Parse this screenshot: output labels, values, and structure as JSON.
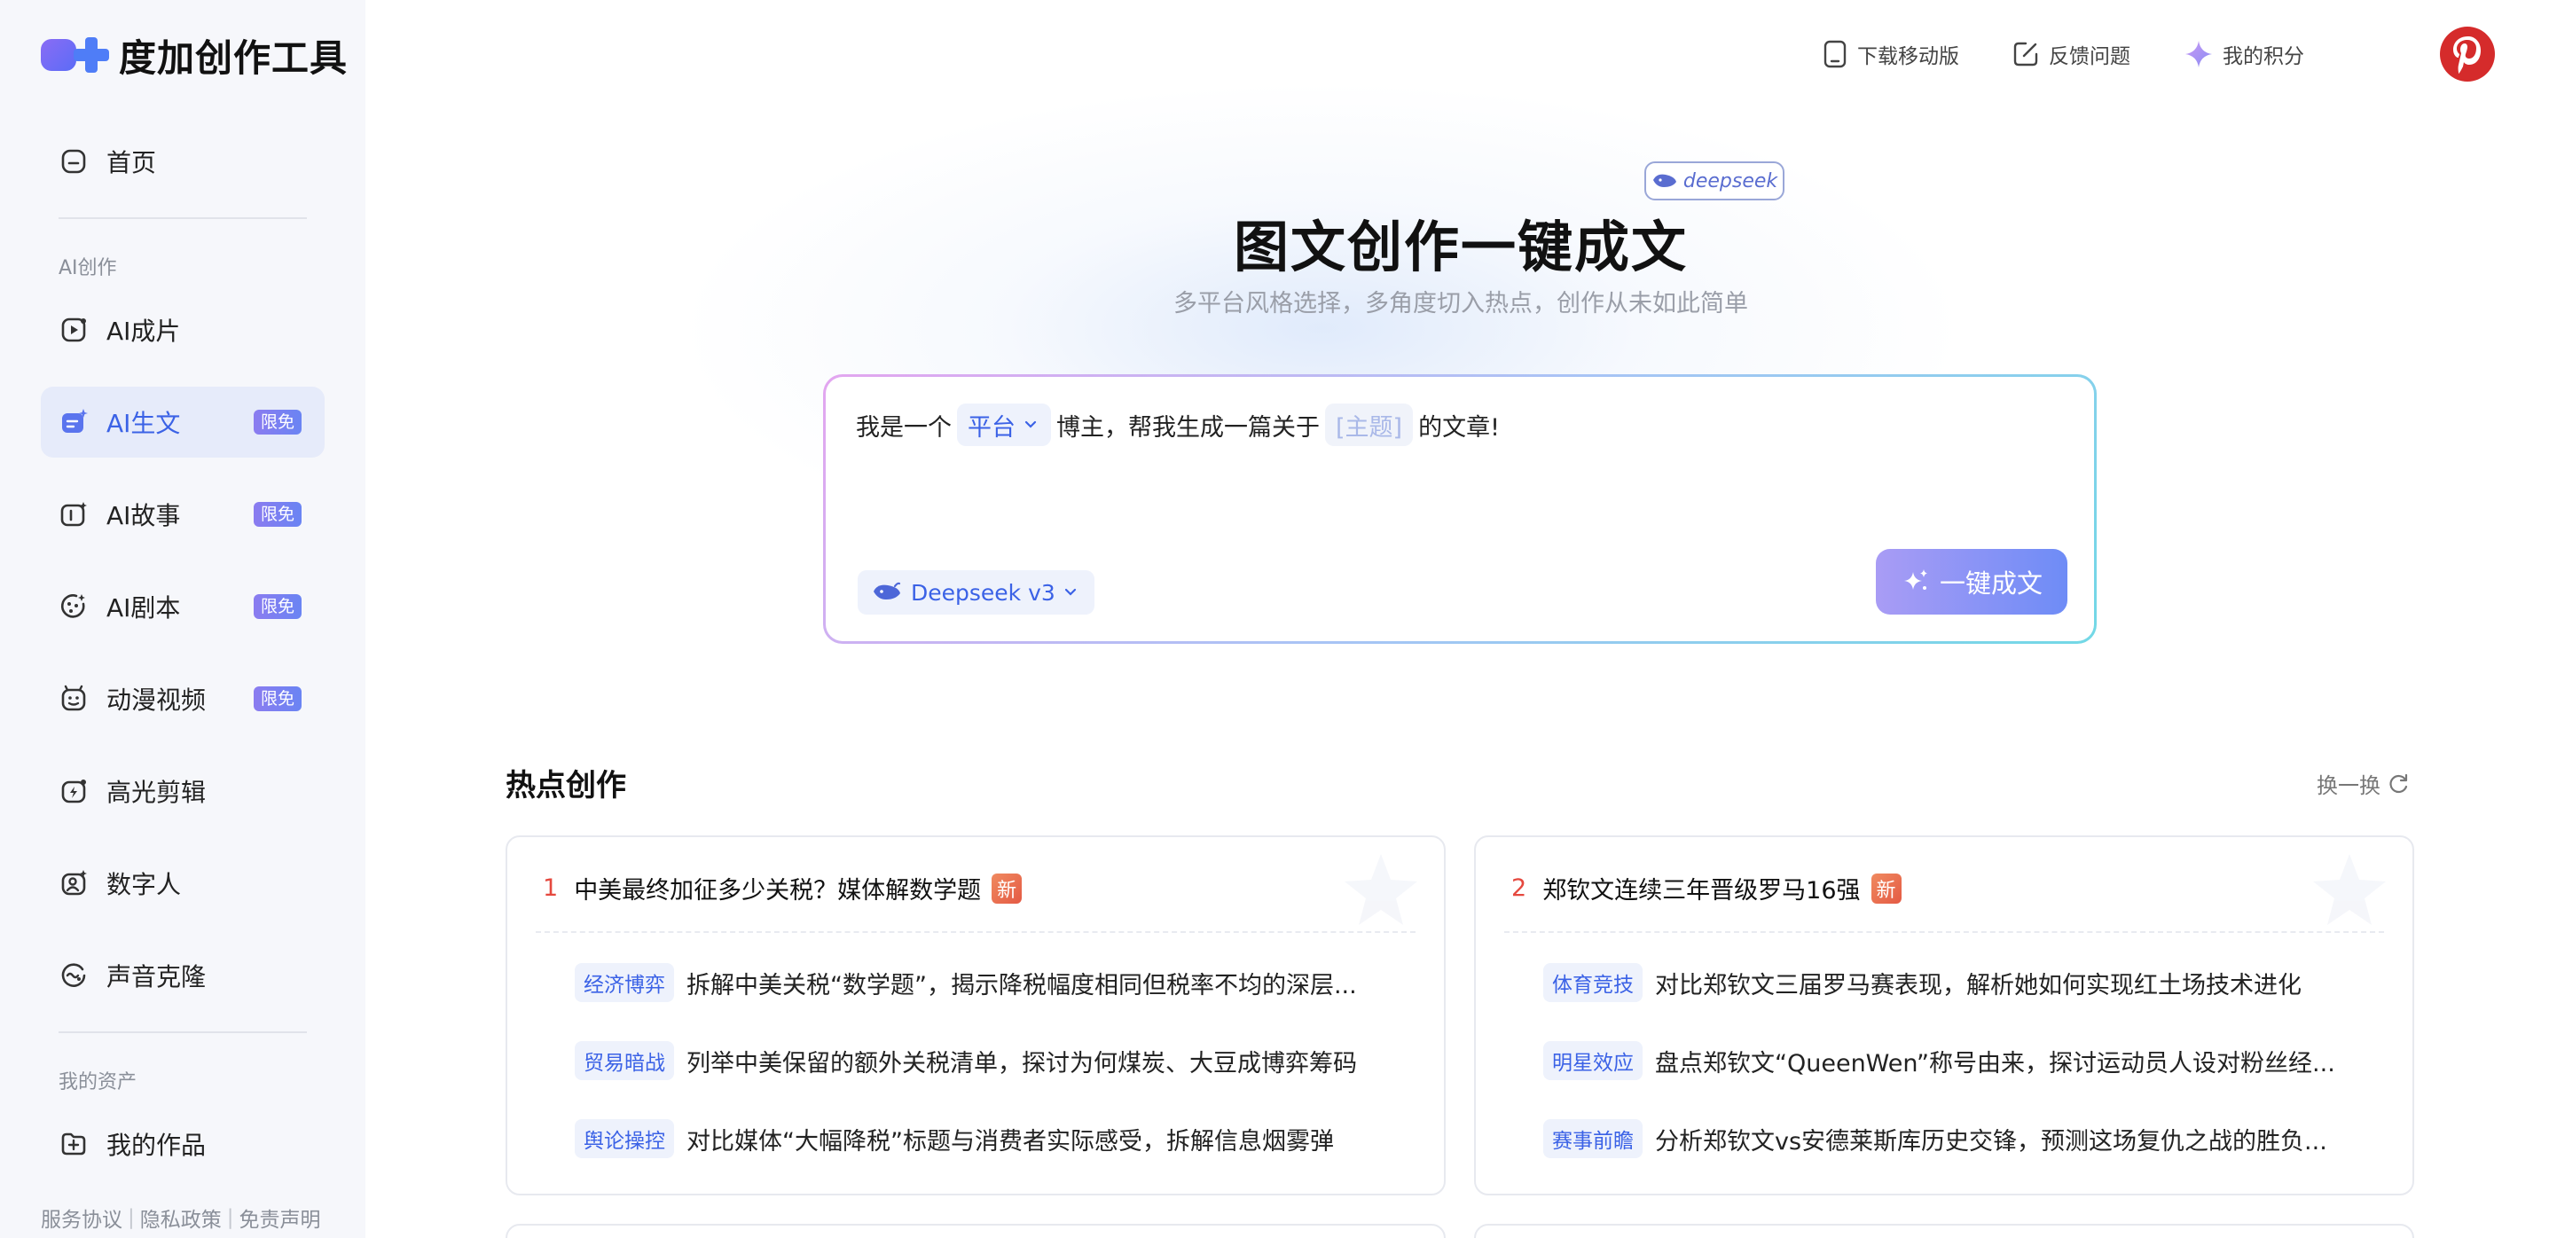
{
  "app": {
    "logo_text": "度加创作工具"
  },
  "sidebar": {
    "home": {
      "label": "首页"
    },
    "section_ai": "AI创作",
    "items": [
      {
        "label": "AI成片",
        "icon": "video-play-icon",
        "badge": ""
      },
      {
        "label": "AI生文",
        "icon": "text-sparkle-icon",
        "badge": "限免",
        "active": true
      },
      {
        "label": "AI故事",
        "icon": "story-icon",
        "badge": "限免"
      },
      {
        "label": "AI剧本",
        "icon": "script-icon",
        "badge": "限免"
      },
      {
        "label": "动漫视频",
        "icon": "anime-icon",
        "badge": "限免"
      },
      {
        "label": "高光剪辑",
        "icon": "highlight-clip-icon",
        "badge": ""
      },
      {
        "label": "数字人",
        "icon": "digital-human-icon",
        "badge": ""
      },
      {
        "label": "声音克隆",
        "icon": "voice-clone-icon",
        "badge": ""
      }
    ],
    "section_assets": "我的资产",
    "my_works": {
      "label": "我的作品"
    },
    "footer": {
      "terms": "服务协议",
      "privacy": "隐私政策",
      "disclaimer": "免责声明"
    }
  },
  "topbar": {
    "download": "下载移动版",
    "feedback": "反馈问题",
    "points": "我的积分"
  },
  "hero": {
    "tag": "deepseek",
    "title": "图文创作一键成文",
    "subtitle": "多平台风格选择，多角度切入热点，创作从未如此简单"
  },
  "composer": {
    "prefix": "我是一个",
    "platform": "平台",
    "middle": "博主，帮我生成一篇关于",
    "topic": "[主题]",
    "suffix": "的文章!",
    "model": "Deepseek v3",
    "generate": "一键成文"
  },
  "hot": {
    "title": "热点创作",
    "refresh": "换一换",
    "cards": [
      {
        "num": "1",
        "title": "中美最终加征多少关税？媒体解数学题",
        "badge": "新",
        "rows": [
          {
            "tag": "经济博弈",
            "text": "拆解中美关税“数学题”，揭示降税幅度相同但税率不均的深层..."
          },
          {
            "tag": "贸易暗战",
            "text": "列举中美保留的额外关税清单，探讨为何煤炭、大豆成博弈筹码"
          },
          {
            "tag": "舆论操控",
            "text": "对比媒体“大幅降税”标题与消费者实际感受，拆解信息烟雾弹"
          }
        ]
      },
      {
        "num": "2",
        "title": "郑钦文连续三年晋级罗马16强",
        "badge": "新",
        "rows": [
          {
            "tag": "体育竞技",
            "text": "对比郑钦文三届罗马赛表现，解析她如何实现红土场技术进化"
          },
          {
            "tag": "明星效应",
            "text": "盘点郑钦文“QueenWen”称号由来，探讨运动员人设对粉丝经..."
          },
          {
            "tag": "赛事前瞻",
            "text": "分析郑钦文vs安德莱斯库历史交锋，预测这场复仇之战的胜负..."
          }
        ]
      }
    ]
  }
}
